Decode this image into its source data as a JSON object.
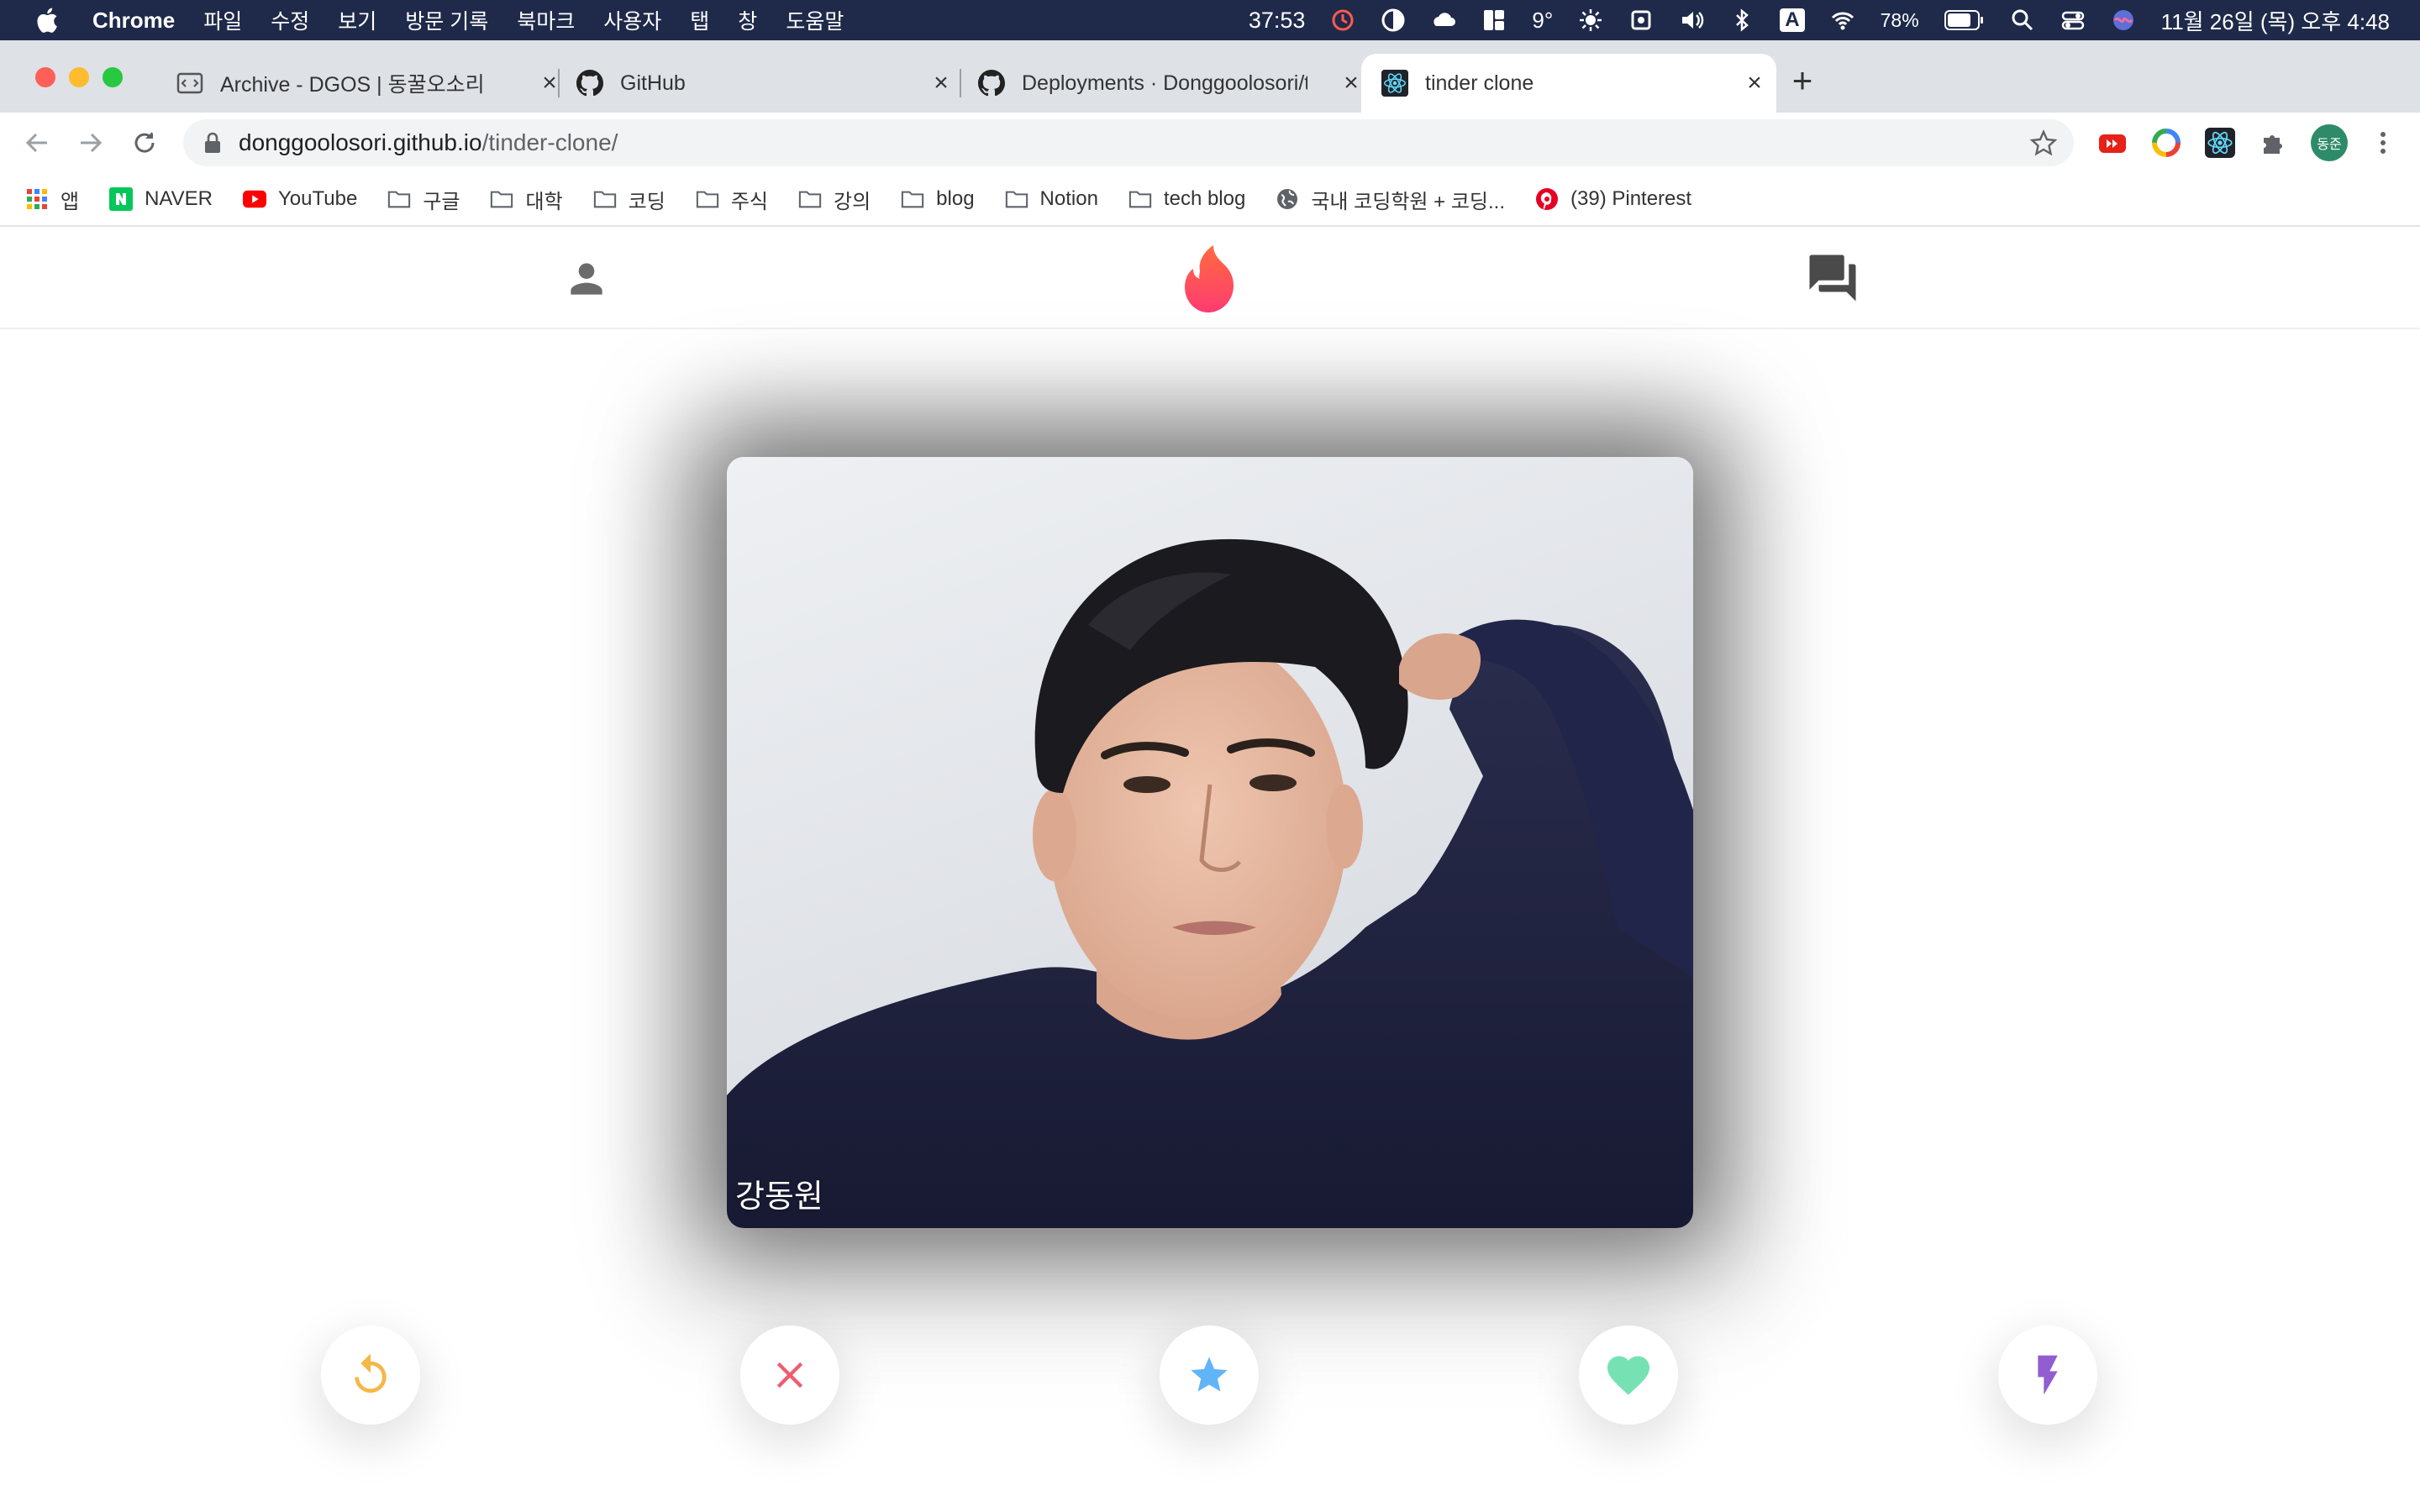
{
  "menubar": {
    "app_name": "Chrome",
    "menus": [
      "파일",
      "수정",
      "보기",
      "방문 기록",
      "북마크",
      "사용자",
      "탭",
      "창",
      "도움말"
    ],
    "timer": "37:53",
    "weather": "9°",
    "battery": "78%",
    "input_indicator": "A",
    "datetime": "11월 26일 (목) 오후 4:48"
  },
  "tabs": [
    {
      "title": "Archive - DGOS | 동꿀오소리",
      "icon": "archive-icon",
      "active": false
    },
    {
      "title": "GitHub",
      "icon": "github-icon",
      "active": false
    },
    {
      "title": "Deployments · Donggoolosori/t",
      "icon": "github-icon",
      "active": false
    },
    {
      "title": "tinder clone",
      "icon": "react-icon",
      "active": true
    }
  ],
  "address_bar": {
    "domain": "donggoolosori.github.io",
    "path": "/tinder-clone/"
  },
  "bookmarks": [
    {
      "label": "앱",
      "icon": "apps-grid-icon"
    },
    {
      "label": "NAVER",
      "icon": "naver-icon"
    },
    {
      "label": "YouTube",
      "icon": "youtube-icon"
    },
    {
      "label": "구글",
      "icon": "folder-icon"
    },
    {
      "label": "대학",
      "icon": "folder-icon"
    },
    {
      "label": "코딩",
      "icon": "folder-icon"
    },
    {
      "label": "주식",
      "icon": "folder-icon"
    },
    {
      "label": "강의",
      "icon": "folder-icon"
    },
    {
      "label": "blog",
      "icon": "folder-icon"
    },
    {
      "label": "Notion",
      "icon": "folder-icon"
    },
    {
      "label": "tech blog",
      "icon": "folder-icon"
    },
    {
      "label": "국내 코딩학원 + 코딩...",
      "icon": "globe-icon"
    },
    {
      "label": "(39) Pinterest",
      "icon": "pinterest-icon"
    }
  ],
  "profile_avatar": "동준",
  "app": {
    "header_icons": [
      "person-icon",
      "tinder-flame-icon",
      "forum-icon"
    ],
    "card": {
      "name": "강동원"
    },
    "actions": [
      {
        "name": "replay",
        "icon": "replay-icon",
        "color": "#f5b748"
      },
      {
        "name": "nope",
        "icon": "close-icon",
        "color": "#ec5e6f"
      },
      {
        "name": "super-like",
        "icon": "star-icon",
        "color": "#62b4f9"
      },
      {
        "name": "like",
        "icon": "heart-icon",
        "color": "#76e2b3"
      },
      {
        "name": "boost",
        "icon": "flash-icon",
        "color": "#915dd1"
      }
    ],
    "brand_color": "#fe3c72"
  }
}
